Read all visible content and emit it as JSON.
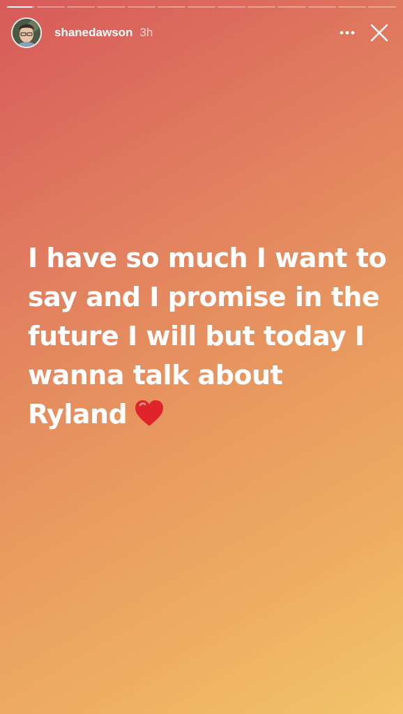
{
  "progress": {
    "segment_count": 13,
    "current_index": 0,
    "current_fraction": 0.9
  },
  "header": {
    "avatar_icon": "profile-photo-avatar",
    "username": "shanedawson",
    "time": "3h",
    "more_icon": "more-options-icon",
    "close_icon": "close-icon"
  },
  "story": {
    "lines": [
      "I have so much I want to",
      "say and I promise in the",
      "future I will but today I",
      "wanna talk about",
      "Ryland"
    ],
    "emoji": "red-heart-icon",
    "text_color": "#ffffff"
  },
  "colors": {
    "gradient_start": "#d75a5a",
    "gradient_end": "#f2c46a"
  }
}
